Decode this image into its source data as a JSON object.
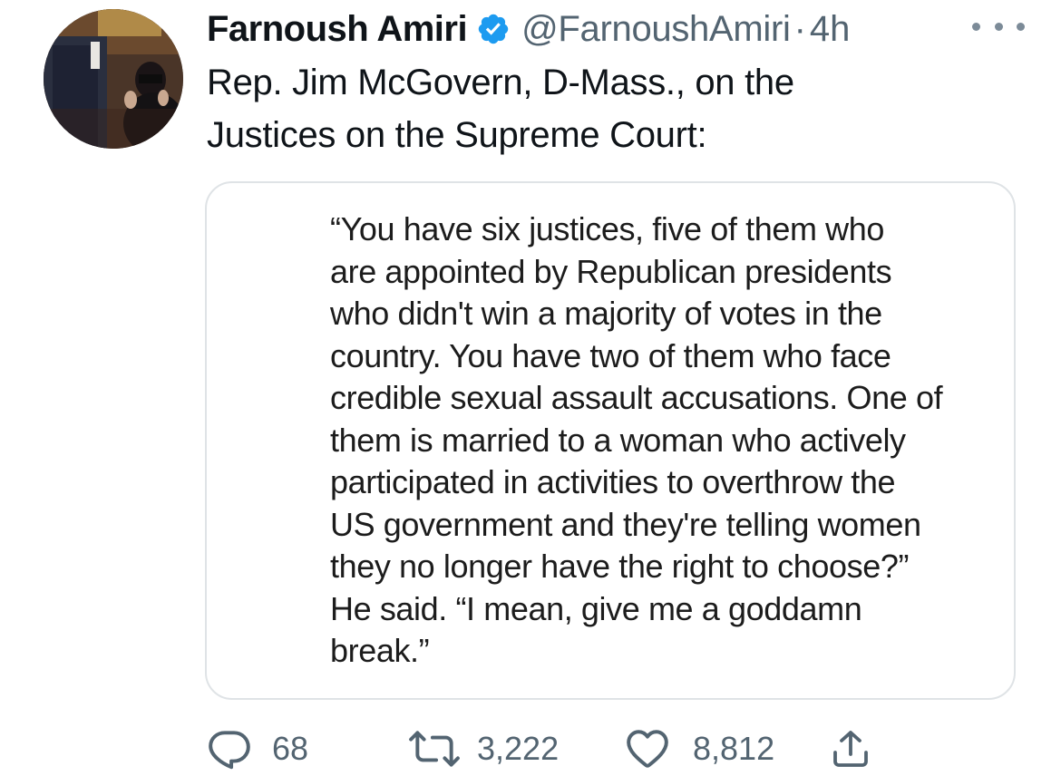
{
  "tweet": {
    "author_name": "Farnoush Amiri",
    "author_handle": "@FarnoushAmiri",
    "separator": "·",
    "time": "4h",
    "text_lines": [
      "Rep. Jim McGovern, D-Mass., on the",
      "Justices on the Supreme Court:"
    ]
  },
  "quote": {
    "lines": [
      "“You have six justices, five of them who",
      "are appointed by Republican presidents",
      "who didn't win a majority of votes in the",
      "country. You have two of them who face",
      "credible sexual assault accusations. One of",
      "them is married to a woman who actively",
      "participated in activities to overthrow the",
      "US government and they're telling women",
      "they no longer have the right to choose?”",
      "He said. “I mean, give me a goddamn",
      "break.”"
    ]
  },
  "actions": {
    "reply_count": "68",
    "retweet_count": "3,222",
    "like_count": "8,812"
  },
  "icons": {
    "verified": "verified-badge-icon",
    "more": "more-options-icon",
    "reply": "reply-icon",
    "retweet": "retweet-icon",
    "like": "heart-icon",
    "share": "share-icon"
  },
  "colors": {
    "verified_blue": "#1d9bf0",
    "secondary_text": "#536471",
    "icon_gray": "#536471",
    "card_border": "#dfe3e6"
  }
}
